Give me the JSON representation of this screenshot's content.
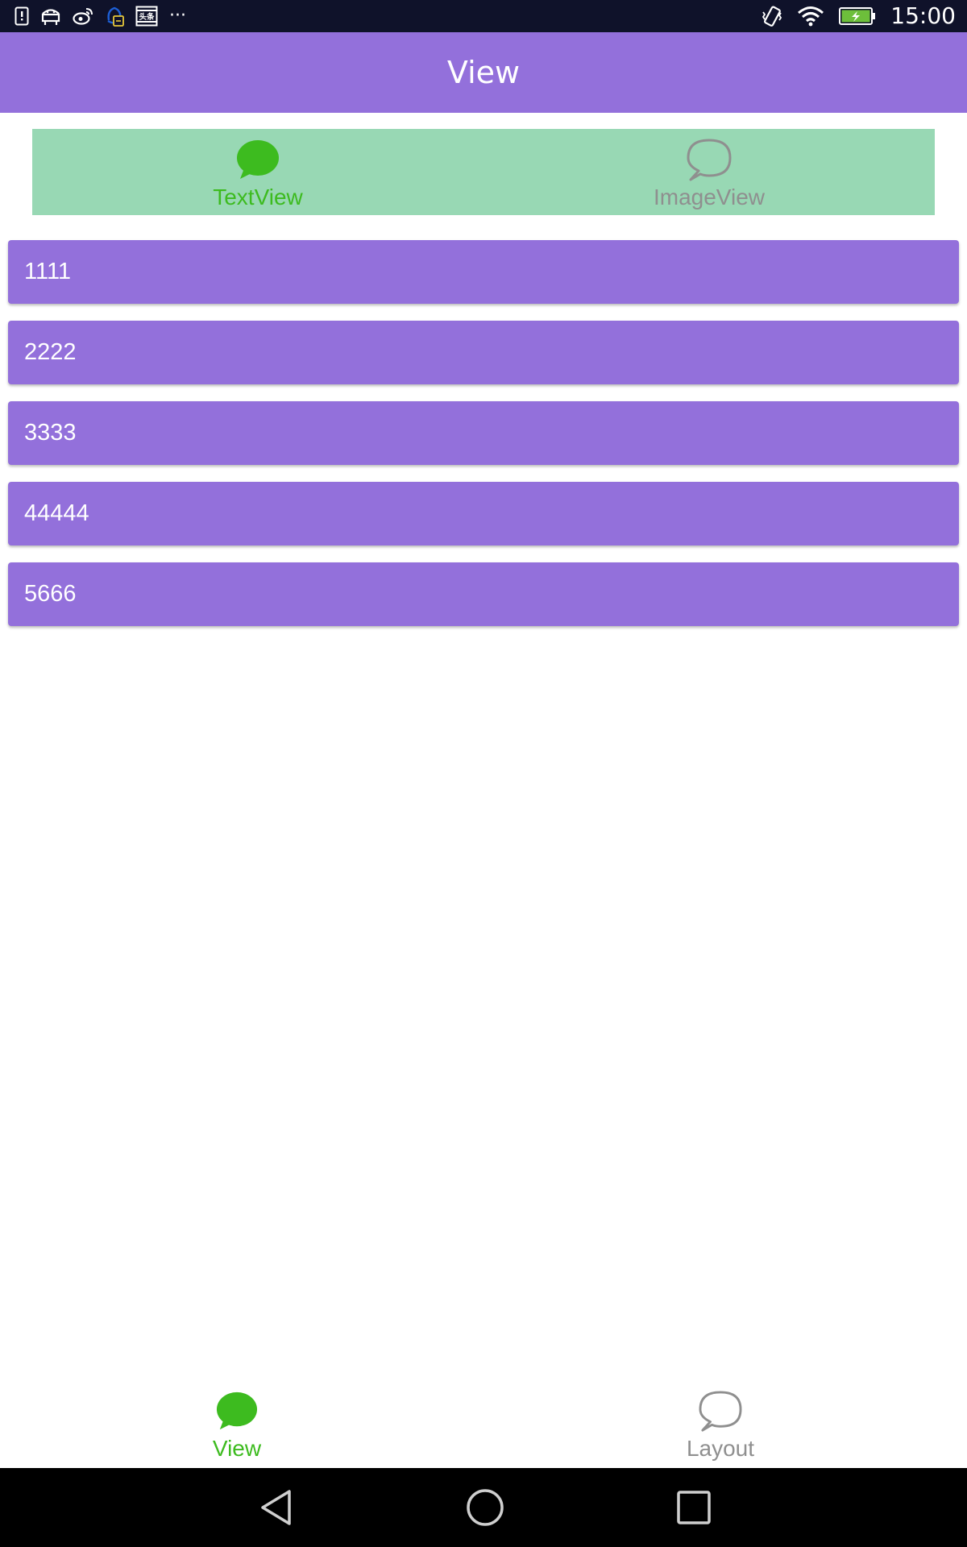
{
  "status_bar": {
    "time": "15:00",
    "notification_icons": [
      "sim-alert-icon",
      "android-debug-icon",
      "weibo-icon",
      "qq-icon",
      "toutiao-icon",
      "more-notifications-icon"
    ],
    "toutiao_badge": "头条",
    "more_glyph": "···",
    "system_icons": [
      "vibrate-icon",
      "wifi-icon",
      "battery-charging-icon"
    ]
  },
  "app_bar": {
    "title": "View"
  },
  "top_tabs": [
    {
      "label": "TextView",
      "icon": "chat-bubble-filled-icon",
      "active": true
    },
    {
      "label": "ImageView",
      "icon": "chat-bubble-outline-icon",
      "active": false
    }
  ],
  "list": {
    "items": [
      "1111",
      "2222",
      "3333",
      "44444",
      "5666"
    ]
  },
  "bottom_nav": [
    {
      "label": "View",
      "icon": "chat-bubble-filled-icon",
      "active": true
    },
    {
      "label": "Layout",
      "icon": "chat-bubble-outline-icon",
      "active": false
    }
  ],
  "system_nav": {
    "buttons": [
      "back-icon",
      "home-icon",
      "recent-apps-icon"
    ]
  },
  "colors": {
    "accent_purple": "#9370db",
    "tab_strip_green": "#98d8b4",
    "active_green": "#3dbb1f",
    "inactive_gray": "#8f8f8f",
    "status_bar": "#0f122a"
  }
}
